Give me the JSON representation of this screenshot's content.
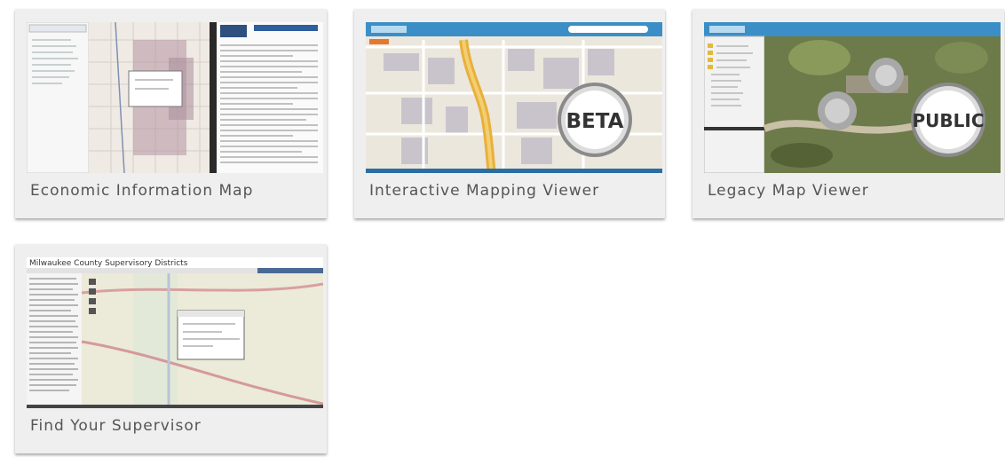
{
  "cards": [
    {
      "label": "Economic Information Map",
      "icon": "economic-map-thumbnail"
    },
    {
      "label": "Interactive Mapping Viewer",
      "icon": "interactive-map-thumbnail",
      "badge": "BETA"
    },
    {
      "label": "Legacy Map Viewer",
      "icon": "legacy-map-thumbnail",
      "badge": "PUBLIC"
    },
    {
      "label": "Find Your Supervisor",
      "icon": "supervisor-map-thumbnail",
      "thumb_title": "Milwaukee County Supervisory Districts"
    }
  ]
}
